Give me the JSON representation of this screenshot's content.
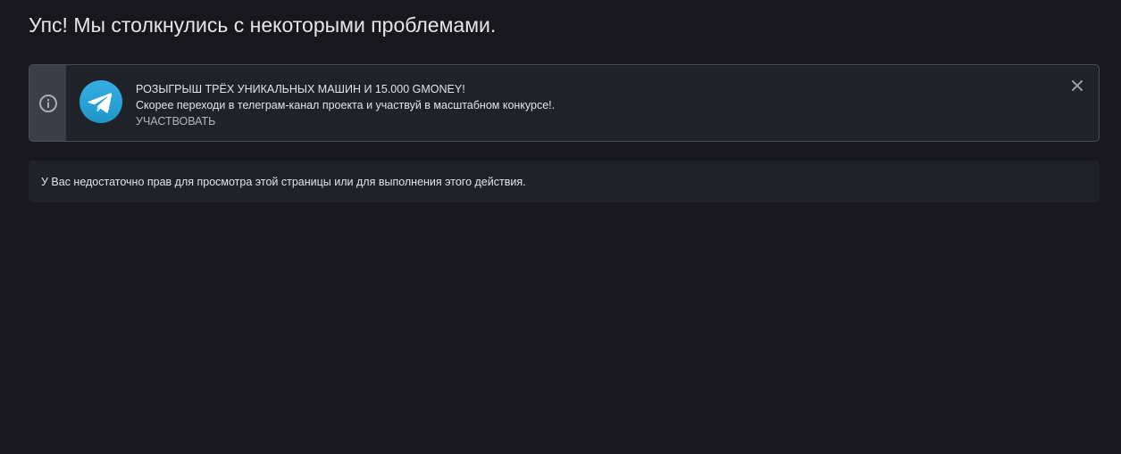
{
  "page": {
    "title": "Упс! Мы столкнулись с некоторыми проблемами."
  },
  "notice": {
    "icon": "info-icon",
    "logo": "telegram-logo",
    "headline": "РОЗЫГРЫШ ТРЁХ УНИКАЛЬНЫХ МАШИН И 15.000 GMONEY!",
    "body": "Скорее переходи в телеграм-канал проекта и участвуй в масштабном конкурсе!.",
    "link_label": "УЧАСТВОВАТЬ",
    "close_icon": "close-icon"
  },
  "error": {
    "message": "У Вас недостаточно прав для просмотра этой страницы или для выполнения этого действия."
  },
  "colors": {
    "background": "#17171d",
    "panel": "#20222a",
    "strip": "#3b3e48",
    "border": "#4a4d57",
    "telegram_blue": "#2aa3dd",
    "text": "#e4e4e8"
  }
}
